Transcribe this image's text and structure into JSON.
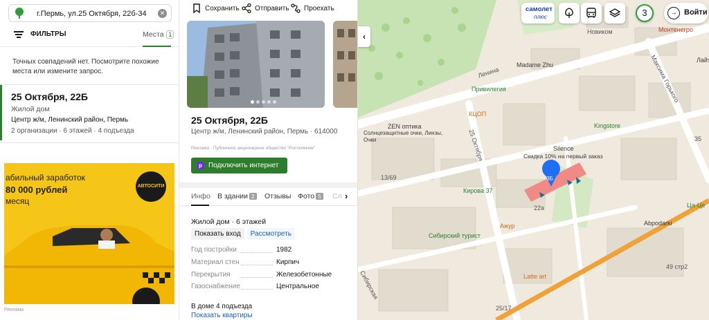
{
  "search": {
    "query": "г.Пермь, ул.25 Октября, 22б-34",
    "logo_icon": "map-pin-logo-icon",
    "clear_icon": "clear-icon"
  },
  "filters": {
    "label": "ФИЛЬТРЫ",
    "places_label": "Места",
    "places_count": "1"
  },
  "no_match": {
    "text": "Точных совпадений нет. Посмотрите похожие места или измените запрос."
  },
  "result": {
    "title": "25 Октября, 22Б",
    "type": "Жилой дом",
    "address": "Центр ж/м, Ленинский район, Пермь",
    "meta": "2 организации · 6 этажей · 4 подъезда"
  },
  "ad": {
    "line1": "абильный заработок",
    "line2": "80 000 рублей",
    "line3": "месяц",
    "badge": "АВТОСИТИ",
    "label": "Реклама"
  },
  "actions": {
    "save": "Сохранить",
    "share": "Отправить",
    "route": "Проехать"
  },
  "place": {
    "title": "25 Октября, 22Б",
    "address": "Центр ж/м, Ленинский район, Пермь · 614000",
    "promo": "Реклама · Публичное акционерное общество \"Ростелеком\"",
    "connect_label": "Подключить интернет"
  },
  "tabs": [
    {
      "label": "Инфо",
      "count": ""
    },
    {
      "label": "В здании",
      "count": "2"
    },
    {
      "label": "Отзывы",
      "count": ""
    },
    {
      "label": "Фото",
      "count": "5"
    },
    {
      "label": "Сл",
      "count": ""
    }
  ],
  "building": {
    "summary": "Жилой дом · 6 этажей",
    "show_entrance": "Показать вход",
    "view": "Рассмотреть",
    "specs": [
      {
        "key": "Год постройки",
        "value": "1982"
      },
      {
        "key": "Материал стен",
        "value": "Кирпич"
      },
      {
        "key": "Перекрытия",
        "value": "Железобетонные"
      },
      {
        "key": "Газоснабжение",
        "value": "Центральное"
      }
    ],
    "entrances": "В доме 4 подъезда",
    "show_flats": "Показать квартиры"
  },
  "map": {
    "collapse": "‹",
    "samolet_1": "самолет",
    "samolet_2": "плюс",
    "traffic": "3",
    "login": "Войти",
    "labels": {
      "novikom": "Новиком",
      "montenegro": "Монтенегро",
      "madame": "Madame Zhu",
      "privileg": "Привилегия",
      "kcop": "КЦОП",
      "zen": "ZEN оптика",
      "zen_sub": "Солнцезащитные очки, Линзы, Очки",
      "oct": "25 Октября",
      "silence": "Silence",
      "silence_sub": "Скидка 10% на первый заказ",
      "kingstore": "Kingstore",
      "kirova": "Кирова 37",
      "n1369": "13/69",
      "azhur": "Ажур",
      "sib_tur": "Сибирский турист",
      "sib": "Сибирская",
      "lenina": "Ленина",
      "gorkogo": "Максима Горького",
      "abrodarki": "Abpodarki",
      "caceta": "Ца-Це",
      "lateart": "Latte art",
      "n49": "49 стр2",
      "n2517": "25/17",
      "n22a": "22а",
      "n35": "35",
      "lait": "Лайт",
      "mark": "3Б"
    }
  }
}
